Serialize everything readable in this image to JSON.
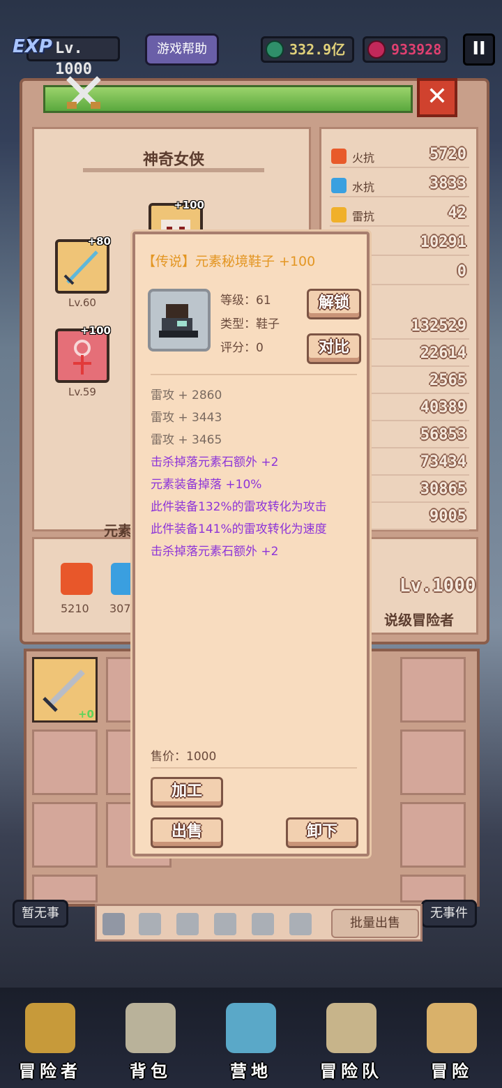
{
  "topbar": {
    "exp_badge": "EXP",
    "level": "Lv. 1000",
    "help_label": "游戏帮助",
    "green_currency": "332.9亿",
    "red_currency": "933928",
    "pause_label": "II"
  },
  "character": {
    "name": "神奇女侠",
    "slots": [
      {
        "plus": "+80",
        "level": "Lv.60",
        "icon": "ice-sword-icon"
      },
      {
        "plus": "+100",
        "level": "Lv.59",
        "icon": "ankh-amulet-icon"
      },
      {
        "plus": "+100",
        "level": "",
        "icon": "helmet-icon"
      }
    ],
    "element_label_partial": "元素令",
    "resists": [
      {
        "label": "火抗",
        "value": "5720",
        "icon": "fire-icon"
      },
      {
        "label": "水抗",
        "value": "3833",
        "icon": "water-icon"
      },
      {
        "label": "雷抗",
        "value": "42",
        "icon": "lightning-icon"
      },
      {
        "label": "抗",
        "value": "10291",
        "icon": ""
      },
      {
        "label": "抗",
        "value": "0",
        "icon": ""
      }
    ],
    "stats": [
      {
        "label": "",
        "value": "132529"
      },
      {
        "label": "",
        "value": "22614"
      },
      {
        "label": "",
        "value": "2565"
      },
      {
        "label": "",
        "value": "40389"
      },
      {
        "label": "",
        "value": "56853"
      },
      {
        "label": "",
        "value": "73434"
      },
      {
        "label": "",
        "value": "30865"
      },
      {
        "label": "",
        "value": "9005"
      }
    ],
    "elements": [
      {
        "value": "5210",
        "icon": "fire-element-icon"
      },
      {
        "value": "3076",
        "icon": "water-element-icon"
      }
    ],
    "big_level": "Lv.1000",
    "rank": "说级冒险者"
  },
  "popup": {
    "title": "【传说】元素秘境鞋子 +100",
    "level_line": "等级：61",
    "type_line": "类型：鞋子",
    "score_line": "评分：0",
    "unlock_label": "解锁",
    "compare_label": "对比",
    "base_attrs": [
      "雷攻 + 2860",
      "雷攻 + 3443",
      "雷攻 + 3465"
    ],
    "special_attrs": [
      "击杀掉落元素石额外 +2",
      "元素装备掉落 +10%",
      "此件装备132%的雷攻转化为攻击",
      "此件装备141%的雷攻转化为速度",
      "击杀掉落元素石额外 +2"
    ],
    "price": "售价：1000",
    "process_label": "加工",
    "sell_label": "出售",
    "unequip_label": "卸下"
  },
  "inventory": {
    "first_item_plus": "+0",
    "bulk_sell_label": "批量出售",
    "left_peek": "暂无事",
    "right_peek": "无事件"
  },
  "nav": [
    {
      "label": "冒险者",
      "icon": "helmet-nav-icon"
    },
    {
      "label": "背包",
      "icon": "backpack-nav-icon"
    },
    {
      "label": "营地",
      "icon": "banner-nav-icon"
    },
    {
      "label": "冒险队",
      "icon": "book-nav-icon"
    },
    {
      "label": "冒险",
      "icon": "sword-nav-icon"
    }
  ],
  "colors": {
    "legend_orange": "#e39623",
    "special_purple": "#8d34d8",
    "panel_beige": "#f8dcbf"
  }
}
